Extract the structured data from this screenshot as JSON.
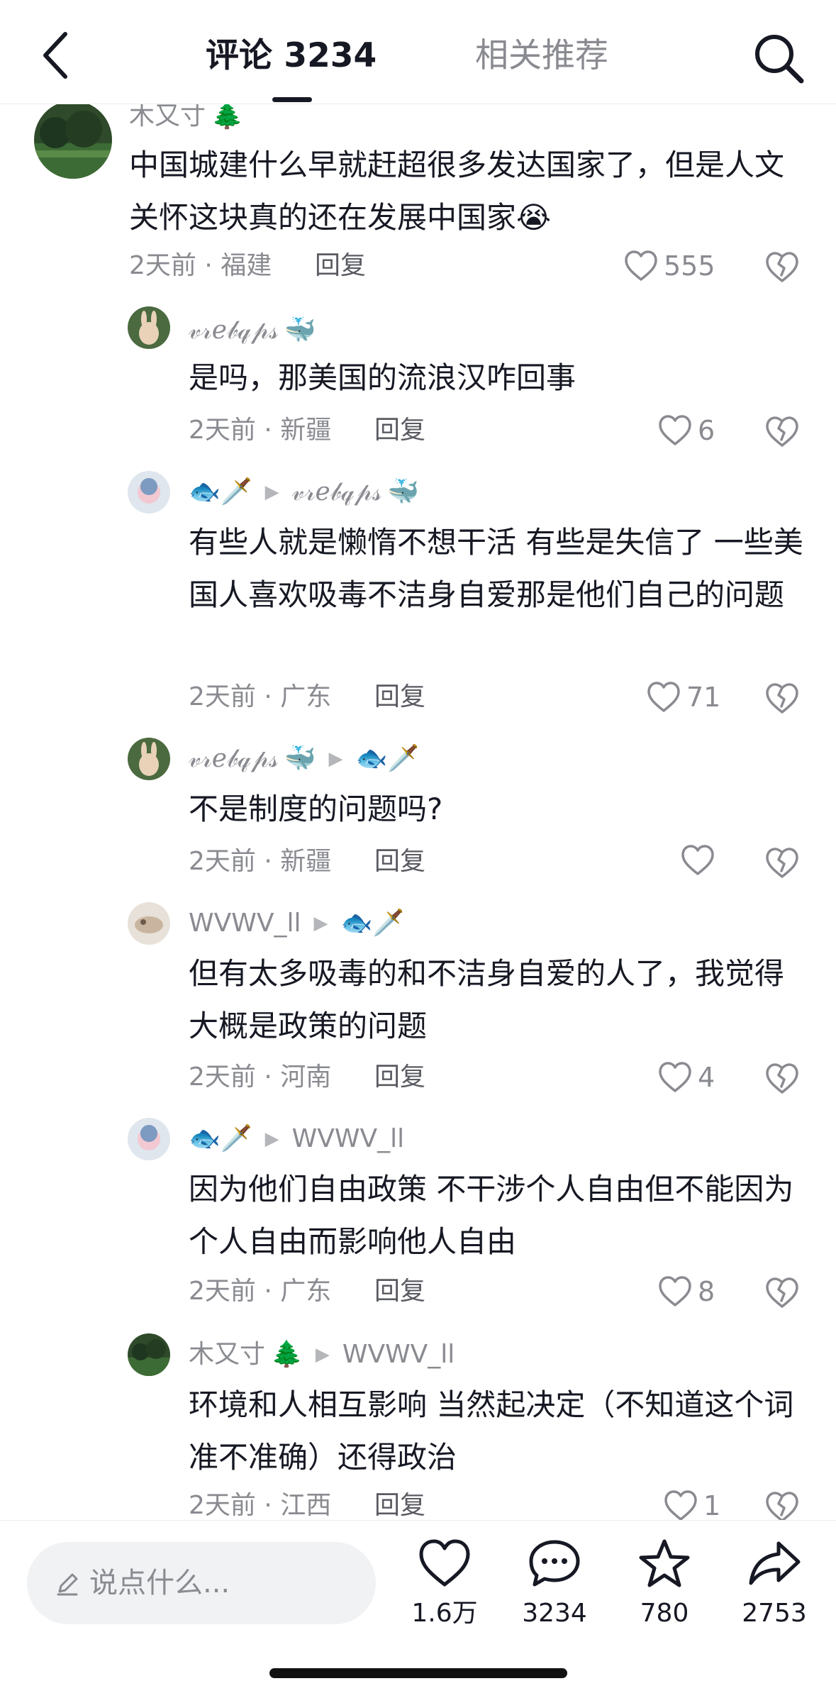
{
  "header": {
    "tab_comments": "评论 3234",
    "tab_related": "相关推荐"
  },
  "comments": [
    {
      "name": "木又寸",
      "name_emoji": "🌲",
      "text": "中国城建什么早就赶超很多发达国家了，但是人文关怀这块真的还在发展中国家",
      "text_emoji": "😭",
      "meta": "2天前 · 福建",
      "reply": "回复",
      "likes": "555"
    },
    {
      "name": "𝓋𝓇ℯ𝒷𝓆𝓅𝓈",
      "name_emoji": "🐳",
      "text": "是吗，那美国的流浪汉咋回事",
      "meta": "2天前 · 新疆",
      "reply": "回复",
      "likes": "6"
    },
    {
      "name_emoji": "🐟🗡️",
      "reply_to": "𝓋𝓇ℯ𝒷𝓆𝓅𝓈",
      "reply_to_emoji": "🐳",
      "text": "有些人就是懒惰不想干活 有些是失信了 一些美国人喜欢吸毒不洁身自爱那是他们自己的问题",
      "meta": "2天前 · 广东",
      "reply": "回复",
      "likes": "71"
    },
    {
      "name": "𝓋𝓇ℯ𝒷𝓆𝓅𝓈",
      "name_emoji": "🐳",
      "reply_to_emoji": "🐟🗡️",
      "text": "不是制度的问题吗?",
      "meta": "2天前 · 新疆",
      "reply": "回复",
      "likes": ""
    },
    {
      "name": "WVWV_ll",
      "reply_to_emoji": "🐟🗡️",
      "text": "但有太多吸毒的和不洁身自爱的人了，我觉得大概是政策的问题",
      "meta": "2天前 · 河南",
      "reply": "回复",
      "likes": "4"
    },
    {
      "name_emoji": "🐟🗡️",
      "reply_to": "WVWV_ll",
      "text": "因为他们自由政策 不干涉个人自由但不能因为个人自由而影响他人自由",
      "meta": "2天前 · 广东",
      "reply": "回复",
      "likes": "8"
    },
    {
      "name": "木又寸",
      "name_emoji": "🌲",
      "reply_to": "WVWV_ll",
      "text": "环境和人相互影响 当然起决定（不知道这个词准不准确）还得政治",
      "meta": "2天前 · 江西",
      "reply": "回复",
      "likes": "1"
    }
  ],
  "bottom_bar": {
    "input_placeholder": "说点什么...",
    "like_count": "1.6万",
    "comment_count": "3234",
    "favorite_count": "780",
    "share_count": "2753"
  },
  "icons": {
    "back": "chevron-left-icon",
    "search": "search-icon",
    "like": "heart-icon",
    "dislike": "broken-heart-icon",
    "pen": "pen-icon",
    "comment": "speech-bubble-icon",
    "favorite": "star-icon",
    "share": "share-arrow-icon"
  }
}
